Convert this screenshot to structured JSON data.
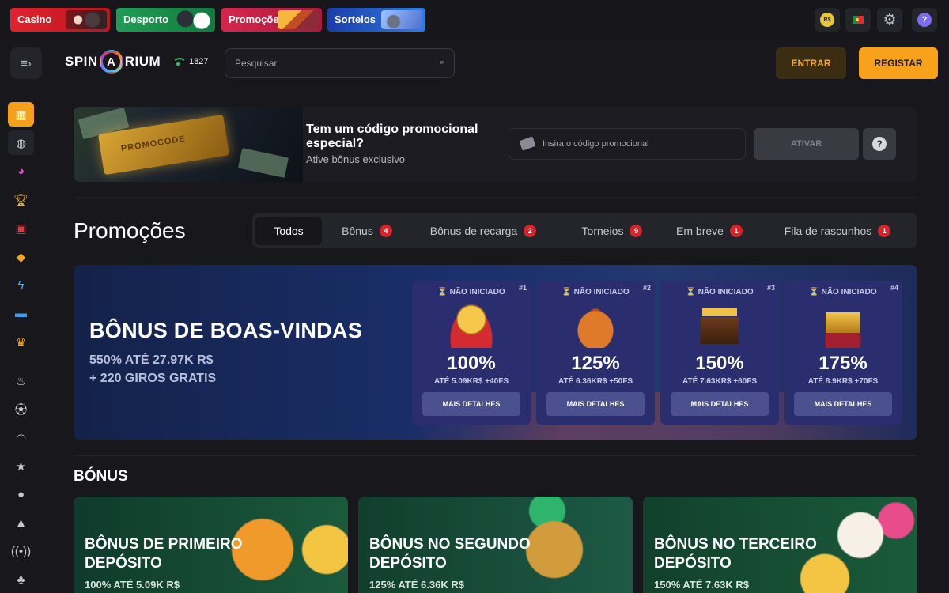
{
  "topbar": {
    "tabs": [
      {
        "label": "Casino"
      },
      {
        "label": "Desporto"
      },
      {
        "label": "Promoções"
      },
      {
        "label": "Sorteios"
      }
    ],
    "currency": "R$"
  },
  "header": {
    "logo": {
      "left": "SPIN",
      "right": "RIUM"
    },
    "online_count": "1827",
    "search": {
      "placeholder": "Pesquisar"
    },
    "login_label": "ENTRAR",
    "register_label": "REGISTAR"
  },
  "promo_code": {
    "ticket_text": "PROMOCODE",
    "title": "Tem um código promocional especial?",
    "subtitle": "Ative bônus exclusivo",
    "input_placeholder": "Insira o código promocional",
    "activate_label": "ATIVAR",
    "help_label": "?"
  },
  "page": {
    "title": "Promoções",
    "filters": [
      {
        "label": "Todos",
        "count": ""
      },
      {
        "label": "Bônus",
        "count": "4"
      },
      {
        "label": "Bônus de recarga",
        "count": "2"
      },
      {
        "label": "Torneios",
        "count": "9"
      },
      {
        "label": "Em breve",
        "count": "1"
      },
      {
        "label": "Fila de rascunhos",
        "count": "1"
      }
    ]
  },
  "welcome": {
    "title": "BÔNUS DE BOAS-VINDAS",
    "line1": "550% ATÉ 27.97K R$",
    "line2": "+ 220 GIROS GRATIS",
    "stages": [
      {
        "status": "NÃO INICIADO",
        "num": "#1",
        "percent": "100%",
        "detail": "ATÉ 5.09KR$ +40FS",
        "button": "MAIS DETALHES"
      },
      {
        "status": "NÃO INICIADO",
        "num": "#2",
        "percent": "125%",
        "detail": "ATÉ 6.36KR$ +50FS",
        "button": "MAIS DETALHES"
      },
      {
        "status": "NÃO INICIADO",
        "num": "#3",
        "percent": "150%",
        "detail": "ATÉ 7.63KR$ +60FS",
        "button": "MAIS DETALHES"
      },
      {
        "status": "NÃO INICIADO",
        "num": "#4",
        "percent": "175%",
        "detail": "ATÉ 8.9KR$ +70FS",
        "button": "MAIS DETALHES"
      }
    ]
  },
  "bonus_section": {
    "title": "BÓNUS",
    "cards": [
      {
        "title": "BÔNUS DE PRIMEIRO DEPÓSITO",
        "subtitle": "100% ATÉ 5.09K R$"
      },
      {
        "title": "BÔNUS NO SEGUNDO DEPÓSITO",
        "subtitle": "125% ATÉ 6.36K R$"
      },
      {
        "title": "BÔNUS NO TERCEIRO DEPÓSITO",
        "subtitle": "150% ATÉ 7.63K R$"
      }
    ]
  },
  "colors": {
    "accent": "#f7a21a",
    "badge": "#d9232b",
    "background": "#17171c"
  }
}
